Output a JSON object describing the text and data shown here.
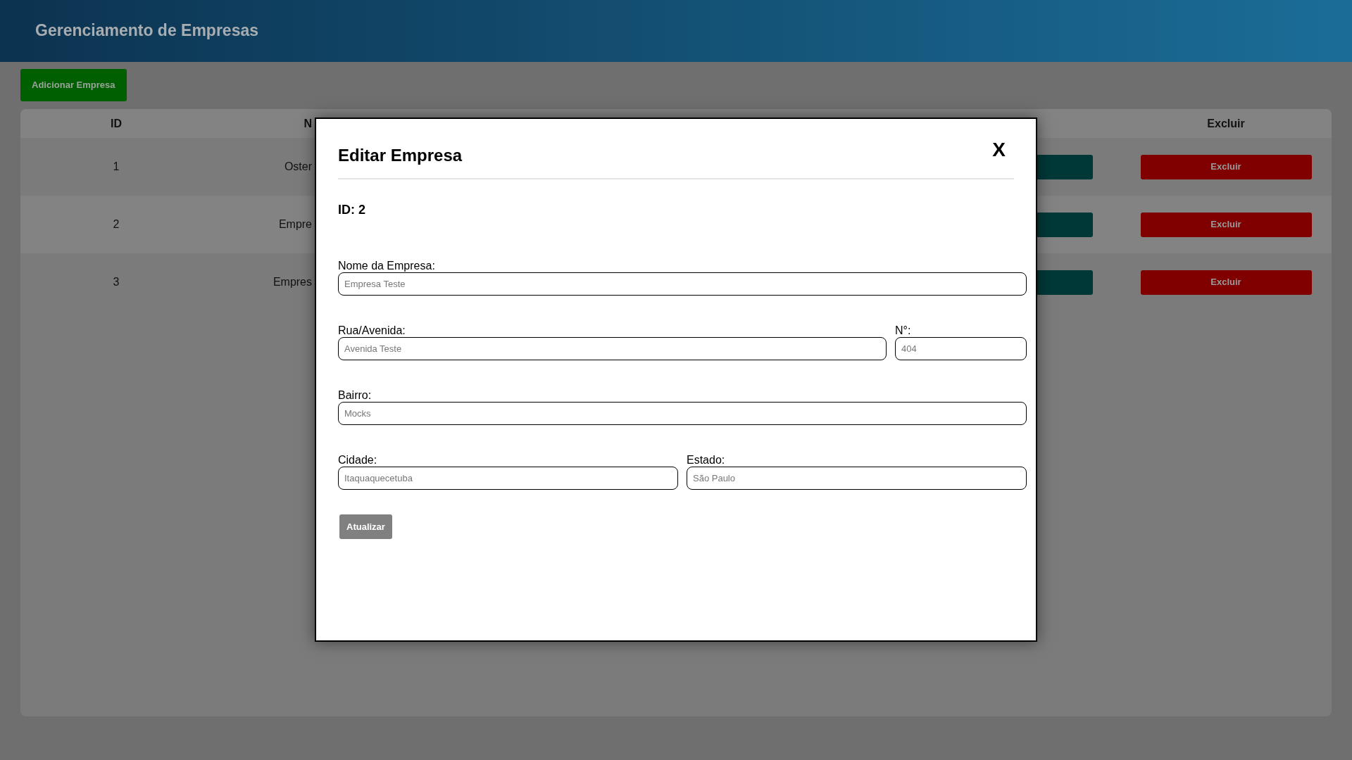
{
  "header": {
    "title": "Gerenciamento de Empresas"
  },
  "add_button": {
    "label": "Adicionar Empresa"
  },
  "table": {
    "columns": {
      "id": "ID",
      "name": "N",
      "delete": "Excluir"
    },
    "rows": [
      {
        "id": "1",
        "name": "Oster",
        "delete_button": "Excluir"
      },
      {
        "id": "2",
        "name": "Empre",
        "delete_button": "Excluir"
      },
      {
        "id": "3",
        "name": "Empres",
        "delete_button": "Excluir"
      }
    ]
  },
  "modal": {
    "title": "Editar Empresa",
    "close": "X",
    "id_label": "ID: 2",
    "field_rows": [
      [
        {
          "label": "Nome da Empresa:",
          "placeholder": "Empresa Teste",
          "kind": "wide"
        }
      ],
      [
        {
          "label": "Rua/Avenida:",
          "placeholder": "Avenida Teste",
          "kind": "wide"
        },
        {
          "label": "N°:",
          "placeholder": "404",
          "kind": "narrow"
        }
      ],
      [
        {
          "label": "Bairro:",
          "placeholder": "Mocks",
          "kind": "wide"
        }
      ],
      [
        {
          "label": "Cidade:",
          "placeholder": "Itaquaquecetuba",
          "kind": "half"
        },
        {
          "label": "Estado:",
          "placeholder": "São Paulo",
          "kind": "half"
        }
      ]
    ],
    "submit": "Atualizar"
  }
}
